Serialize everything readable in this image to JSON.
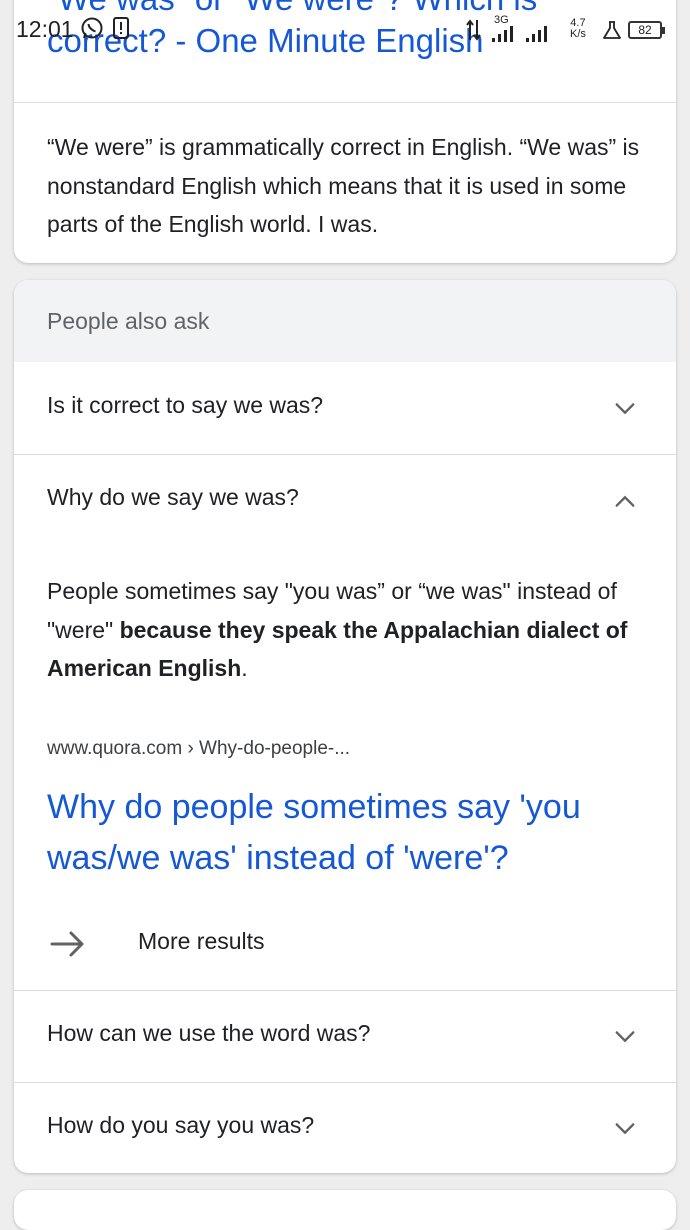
{
  "status_bar": {
    "time": "12:01",
    "network_type": "3G",
    "net_speed_value": "4.7",
    "net_speed_unit": "K/s",
    "battery": "82"
  },
  "result": {
    "title": "“We was” or “We were”? Which is correct? - One Minute English",
    "title_line1": "“We was” or “We were”? Which is",
    "title_line2": "correct? - One Minute English",
    "snippet": "“We were” is grammatically correct in English. “We was” is nonstandard English which means that it is used in some parts of the English world. I was."
  },
  "people_also_ask": {
    "header": "People also ask",
    "questions": [
      {
        "text": "Is it correct to say we was?",
        "expanded": false
      },
      {
        "text": "Why do we say we was?",
        "expanded": true
      },
      {
        "text": "How can we use the word was?",
        "expanded": false
      },
      {
        "text": "How do you say you was?",
        "expanded": false
      }
    ],
    "answer": {
      "text_before": "People sometimes say \"you was” or “we was\" instead of \"were\" ",
      "text_bold": "because they speak the Appalachian dialect of American English",
      "text_after": ".",
      "source": "www.quora.com › Why-do-people-...",
      "link_title": "Why do people sometimes say 'you was/we was' instead of 'were'?"
    },
    "more_results_label": "More results"
  },
  "colors": {
    "link": "#1558d6",
    "paa_header_bg": "#f1f3f4",
    "page_bg": "#eeeeee"
  }
}
